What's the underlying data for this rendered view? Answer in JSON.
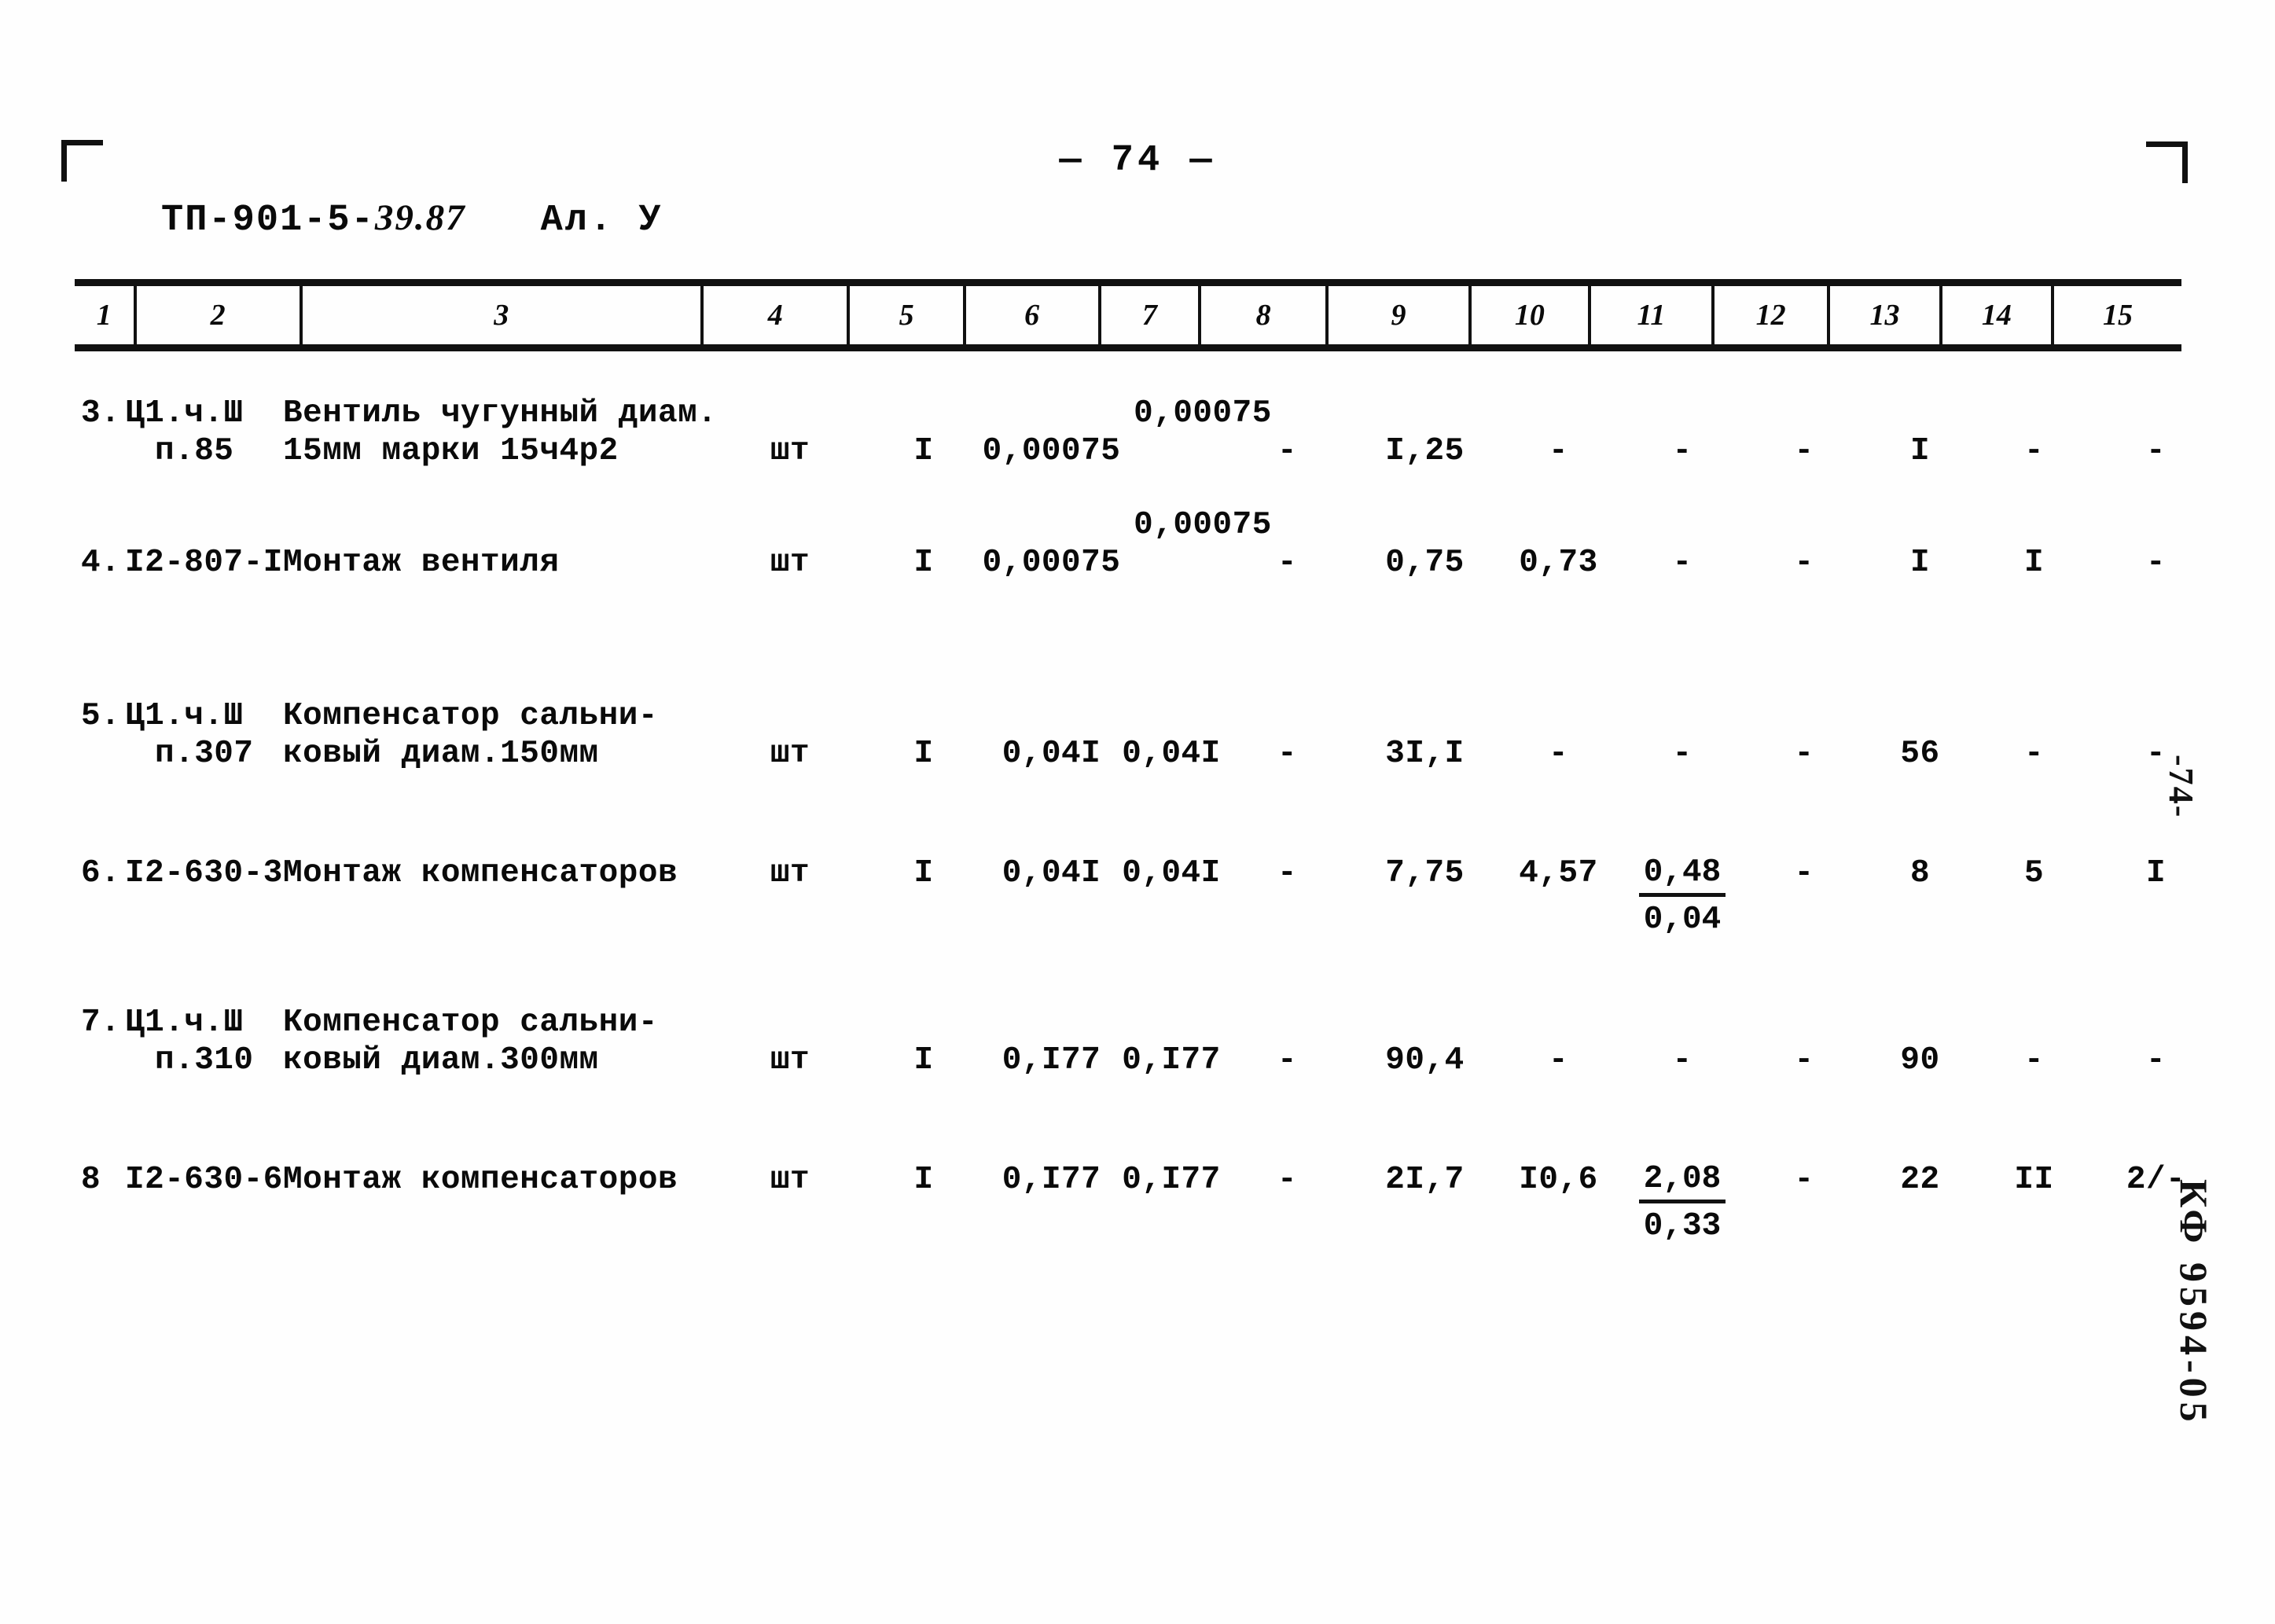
{
  "page": {
    "page_label": "— 74 —",
    "doc_code_prefix": "ТП-901-5-",
    "doc_code_suffix": "39.87",
    "album_label": "Ал. У",
    "margin_page_mark": "-74-",
    "archive_stamp": "КФ 9594-05"
  },
  "table": {
    "column_headers": [
      "1",
      "2",
      "3",
      "4",
      "5",
      "6",
      "7",
      "8",
      "9",
      "10",
      "11",
      "12",
      "13",
      "14",
      "15"
    ],
    "rows": [
      {
        "c1": "3.",
        "c2_line1": "Ц1.ч.Ш",
        "c2_line2": "п.85",
        "c3_line1": "Вентиль чугунный диам.",
        "c3_line2": "15мм марки 15ч4р2",
        "c4": "шт",
        "c5": "I",
        "c6": "0,00075",
        "c6_sup": "0,00075",
        "c7": "",
        "c8": "-",
        "c9": "I,25",
        "c10": "-",
        "c11": "-",
        "c12": "-",
        "c13": "I",
        "c14": "-",
        "c15": "-"
      },
      {
        "c1": "4.",
        "c2_line1": "I2-807-I",
        "c2_line2": "",
        "c3_line1": "Монтаж вентиля",
        "c3_line2": "",
        "c4": "шт",
        "c5": "I",
        "c6": "0,00075",
        "c6_sup": "0,00075",
        "c7": "",
        "c8": "-",
        "c9": "0,75",
        "c10": "0,73",
        "c11": "-",
        "c12": "-",
        "c13": "I",
        "c14": "I",
        "c15": "-"
      },
      {
        "c1": "5.",
        "c2_line1": "Ц1.ч.Ш",
        "c2_line2": "п.307",
        "c3_line1": "Компенсатор сальни-",
        "c3_line2": "ковый диам.150мм",
        "c4": "шт",
        "c5": "I",
        "c6": "0,04I",
        "c6_sup": "",
        "c7": "0,04I",
        "c8": "-",
        "c9": "3I,I",
        "c10": "-",
        "c11": "-",
        "c12": "-",
        "c13": "56",
        "c14": "-",
        "c15": "-"
      },
      {
        "c1": "6.",
        "c2_line1": "I2-630-3",
        "c2_line2": "",
        "c3_line1": "Монтаж компенсаторов",
        "c3_line2": "",
        "c4": "шт",
        "c5": "I",
        "c6": "0,04I",
        "c6_sup": "",
        "c7": "0,04I",
        "c8": "-",
        "c9": "7,75",
        "c10": "4,57",
        "c11_num": "0,48",
        "c11_den": "0,04",
        "c12": "-",
        "c13": "8",
        "c14": "5",
        "c15": "I"
      },
      {
        "c1": "7.",
        "c2_line1": "Ц1.ч.Ш",
        "c2_line2": "п.310",
        "c3_line1": "Компенсатор сальни-",
        "c3_line2": "ковый диам.300мм",
        "c4": "шт",
        "c5": "I",
        "c6": "0,I77",
        "c6_sup": "",
        "c7": "0,I77",
        "c8": "-",
        "c9": "90,4",
        "c10": "-",
        "c11": "-",
        "c12": "-",
        "c13": "90",
        "c14": "-",
        "c15": "-"
      },
      {
        "c1": "8",
        "c2_line1": "I2-630-6",
        "c2_line2": "",
        "c3_line1": "Монтаж компенсаторов",
        "c3_line2": "",
        "c4": "шт",
        "c5": "I",
        "c6": "0,I77",
        "c6_sup": "",
        "c7": "0,I77",
        "c8": "-",
        "c9": "2I,7",
        "c10": "I0,6",
        "c11_num": "2,08",
        "c11_den": "0,33",
        "c12": "-",
        "c13": "22",
        "c14": "II",
        "c15": "2/-"
      }
    ]
  }
}
